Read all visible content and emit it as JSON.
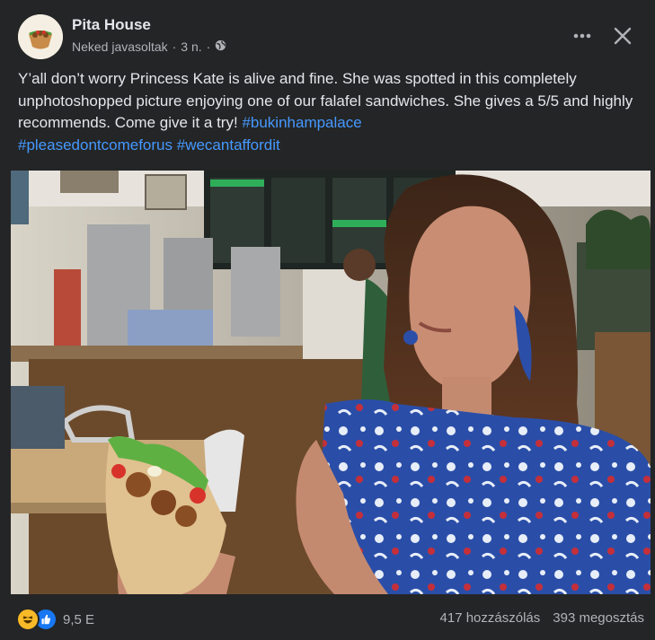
{
  "post": {
    "page_name": "Pita House",
    "suggestion_label": "Neked javasoltak",
    "separator": "·",
    "time_ago": "3 n.",
    "separator2": "·",
    "text": "Y’all don’t worry Princess Kate is alive and fine. She was spotted in this completely unphotoshopped picture enjoying one of our falafel sandwiches. She gives a 5/5 and highly recommends. Come give it a try!",
    "hashtags": [
      "#bukinhampalace",
      "#pleasedontcomeforus",
      "#wecantaffordit"
    ],
    "icons": {
      "privacy": "globe-icon",
      "more": "more-dots-icon",
      "close": "close-icon",
      "reaction1": "haha-reaction-icon",
      "reaction2": "like-reaction-icon"
    }
  },
  "footer": {
    "reaction_count": "9,5 E",
    "comments": "417 hozzászólás",
    "shares": "393 megosztás"
  },
  "colors": {
    "background": "#242526",
    "text": "#e4e6eb",
    "secondary": "#b0b3b8",
    "link": "#4599ff",
    "like_blue": "#1877f2",
    "haha_yellow": "#f7b928"
  }
}
